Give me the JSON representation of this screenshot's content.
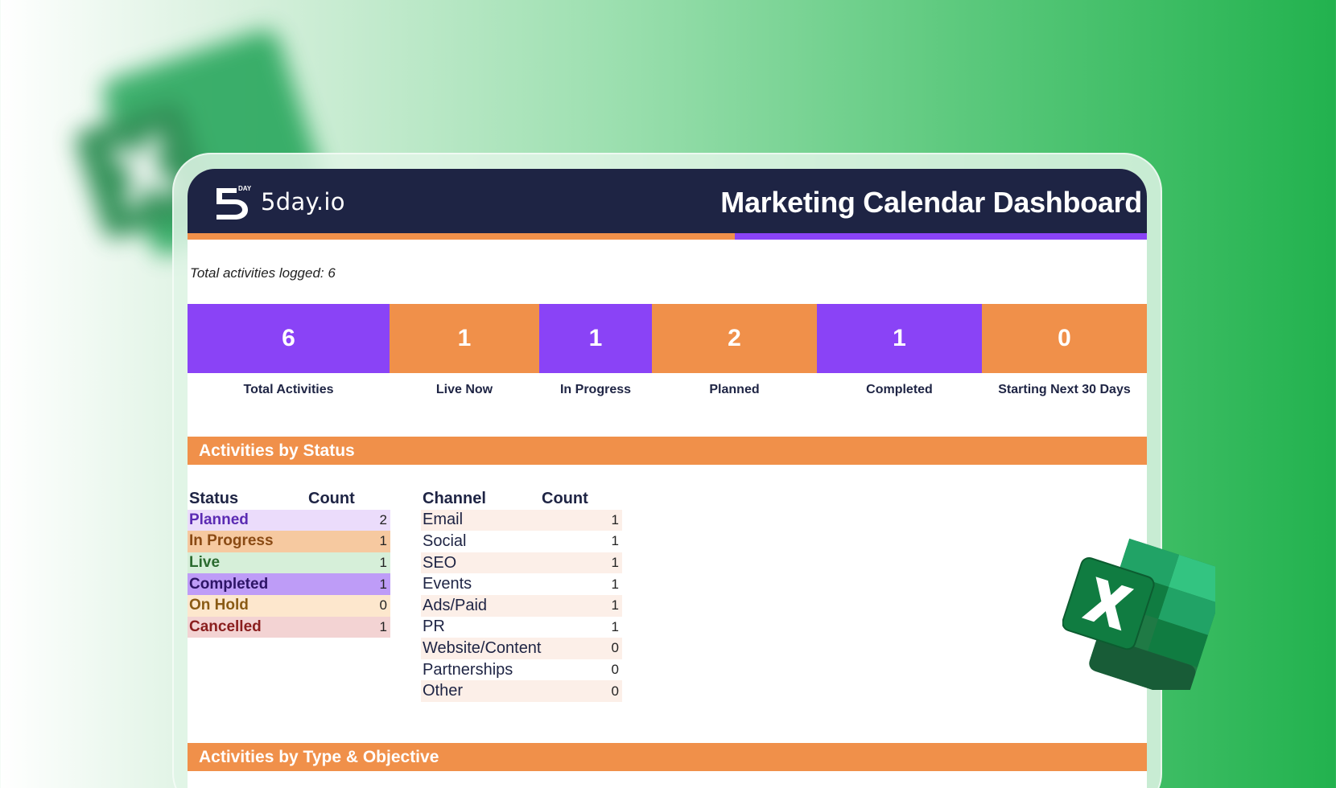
{
  "brand": {
    "name": "5day.io",
    "mark_small_text": "DAY"
  },
  "dashboard_title": "Marketing Calendar Dashboard",
  "total_logged": "Total activities logged: 6",
  "kpis": [
    {
      "value": "6",
      "label": "Total Activities",
      "color": "#8a43f6"
    },
    {
      "value": "1",
      "label": "Live Now",
      "color": "#f0904a"
    },
    {
      "value": "1",
      "label": "In Progress",
      "color": "#8a43f6"
    },
    {
      "value": "2",
      "label": "Planned",
      "color": "#f0904a"
    },
    {
      "value": "1",
      "label": "Completed",
      "color": "#8a43f6"
    },
    {
      "value": "0",
      "label": "Starting Next 30 Days",
      "color": "#f0904a"
    }
  ],
  "sections": {
    "status": "Activities by Status",
    "type_objective": "Activities by Type & Objective"
  },
  "status_table": {
    "headers": [
      "Status",
      "Count"
    ],
    "rows": [
      {
        "status": "Planned",
        "count": "2",
        "bg": "#ebdcfb",
        "fg": "#5b2bb3"
      },
      {
        "status": "In Progress",
        "count": "1",
        "bg": "#f6c9a0",
        "fg": "#8a4a14"
      },
      {
        "status": "Live",
        "count": "1",
        "bg": "#d6efd9",
        "fg": "#2b6b2f"
      },
      {
        "status": "Completed",
        "count": "1",
        "bg": "#be9cf7",
        "fg": "#2d1466"
      },
      {
        "status": "On Hold",
        "count": "0",
        "bg": "#fde7cd",
        "fg": "#8a5a14"
      },
      {
        "status": "Cancelled",
        "count": "1",
        "bg": "#f3d3d3",
        "fg": "#8a1e1e"
      }
    ]
  },
  "channel_table": {
    "headers": [
      "Channel",
      "Count"
    ],
    "rows": [
      {
        "channel": "Email",
        "count": "1"
      },
      {
        "channel": "Social",
        "count": "1"
      },
      {
        "channel": "SEO",
        "count": "1"
      },
      {
        "channel": "Events",
        "count": "1"
      },
      {
        "channel": "Ads/Paid",
        "count": "1"
      },
      {
        "channel": "PR",
        "count": "1"
      },
      {
        "channel": "Website/Content",
        "count": "0"
      },
      {
        "channel": "Partnerships",
        "count": "0"
      },
      {
        "channel": "Other",
        "count": "0"
      }
    ]
  },
  "icons": {
    "excel": "excel-logo-icon",
    "brand": "5day-logo-icon"
  },
  "colors": {
    "header_bg": "#1e2444",
    "accent_orange": "#f0904a",
    "accent_purple": "#8a43f6",
    "excel_green": "#1f7a45"
  }
}
